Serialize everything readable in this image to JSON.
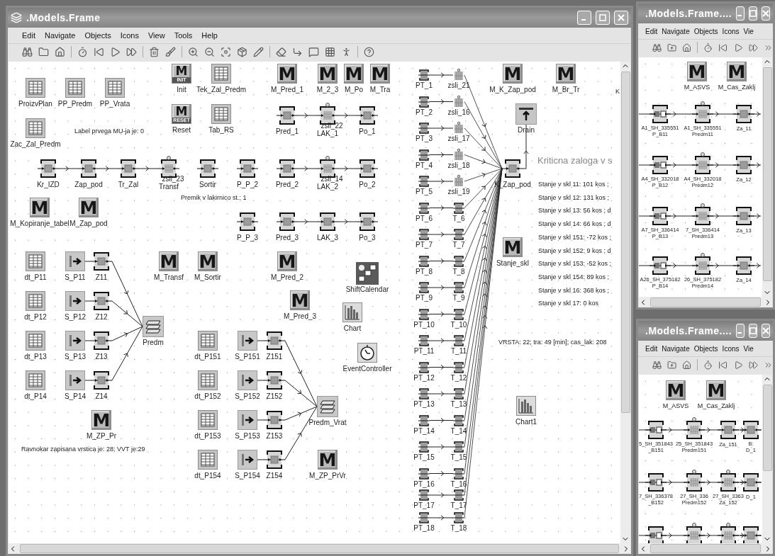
{
  "main_window": {
    "title": ".Models.Frame",
    "menu": [
      "Edit",
      "Navigate",
      "Objects",
      "Icons",
      "View",
      "Tools",
      "Help"
    ],
    "nodes": [
      {
        "kind": "table",
        "label": "ProizvPlan"
      },
      {
        "kind": "table",
        "label": "PP_Predm"
      },
      {
        "kind": "table",
        "label": "PP_Vrata"
      },
      {
        "kind": "init",
        "label": "Init",
        "icon": "M",
        "badge": "INIT"
      },
      {
        "kind": "table",
        "label": "Tek_Zal_Predm"
      },
      {
        "kind": "method",
        "label": "M_Pred_1",
        "icon": "M"
      },
      {
        "kind": "method",
        "label": "M_2_3",
        "icon": "M"
      },
      {
        "kind": "method",
        "label": "M_Po",
        "icon": "M"
      },
      {
        "kind": "method",
        "label": "M_Tra",
        "icon": "M"
      },
      {
        "kind": "method",
        "label": "M_K_Zap_pod",
        "icon": "M"
      },
      {
        "kind": "method",
        "label": "M_Br_Tr",
        "icon": "M"
      },
      {
        "kind": "table",
        "label": "Zac_Zal_Predm"
      },
      {
        "kind": "init",
        "label": "Reset",
        "icon": "M",
        "badge": "RESET"
      },
      {
        "kind": "table",
        "label": "Tab_RS"
      },
      {
        "kind": "station",
        "label": "Pred_1"
      },
      {
        "kind": "parallel",
        "label": "LAK_1",
        "sublabel": "zsli_22"
      },
      {
        "kind": "station",
        "label": "Po_1"
      },
      {
        "kind": "drain",
        "label": "Drain"
      },
      {
        "kind": "station",
        "label": "Kr_IZD"
      },
      {
        "kind": "station",
        "label": "Zap_pod"
      },
      {
        "kind": "station",
        "label": "Tr_Zal"
      },
      {
        "kind": "parallel",
        "label": "Transf",
        "sublabel": "zsli_23"
      },
      {
        "kind": "station",
        "label": "Sortir"
      },
      {
        "kind": "station",
        "label": "P_P_2"
      },
      {
        "kind": "station",
        "label": "Pred_2"
      },
      {
        "kind": "parallel",
        "label": "LAK_2",
        "sublabel": "zsli_14"
      },
      {
        "kind": "station",
        "label": "Po_2"
      },
      {
        "kind": "station",
        "label": "K_Zap_pod"
      },
      {
        "kind": "method",
        "label": "M_Kopiranje_tabel",
        "icon": "M"
      },
      {
        "kind": "method",
        "label": "M_Zap_pod",
        "icon": "M"
      },
      {
        "kind": "station",
        "label": "P_P_3"
      },
      {
        "kind": "station",
        "label": "Pred_3"
      },
      {
        "kind": "station",
        "label": "LAK_3"
      },
      {
        "kind": "station",
        "label": "Po_3"
      },
      {
        "kind": "method",
        "label": "Stanje_skl",
        "icon": "M"
      },
      {
        "kind": "table",
        "label": "dt_P11"
      },
      {
        "kind": "source",
        "label": "S_P11"
      },
      {
        "kind": "station",
        "label": "Z11"
      },
      {
        "kind": "method",
        "label": "M_Transf",
        "icon": "M"
      },
      {
        "kind": "method",
        "label": "M_Sortir",
        "icon": "M"
      },
      {
        "kind": "method",
        "label": "M_Pred_2",
        "icon": "M"
      },
      {
        "kind": "calendar",
        "label": "ShiftCalendar"
      },
      {
        "kind": "table",
        "label": "dt_P12"
      },
      {
        "kind": "source",
        "label": "S_P12"
      },
      {
        "kind": "station",
        "label": "Z12"
      },
      {
        "kind": "method",
        "label": "M_Pred_3",
        "icon": "M"
      },
      {
        "kind": "chart",
        "label": "Chart"
      },
      {
        "kind": "assembly",
        "label": "Predm"
      },
      {
        "kind": "table",
        "label": "dt_P13"
      },
      {
        "kind": "source",
        "label": "S_P13"
      },
      {
        "kind": "station",
        "label": "Z13"
      },
      {
        "kind": "table",
        "label": "dt_P151"
      },
      {
        "kind": "source",
        "label": "S_P151"
      },
      {
        "kind": "station",
        "label": "Z151"
      },
      {
        "kind": "event",
        "label": "EventController"
      },
      {
        "kind": "table",
        "label": "dt_P14"
      },
      {
        "kind": "source",
        "label": "S_P14"
      },
      {
        "kind": "station",
        "label": "Z14"
      },
      {
        "kind": "table",
        "label": "dt_P152"
      },
      {
        "kind": "source",
        "label": "S_P152"
      },
      {
        "kind": "station",
        "label": "Z152"
      },
      {
        "kind": "chart",
        "label": "Chart1"
      },
      {
        "kind": "assembly",
        "label": "Predm_Vrat"
      },
      {
        "kind": "method",
        "label": "M_ZP_Pr",
        "icon": "M"
      },
      {
        "kind": "table",
        "label": "dt_P153"
      },
      {
        "kind": "source",
        "label": "S_P153"
      },
      {
        "kind": "station",
        "label": "Z153"
      },
      {
        "kind": "table",
        "label": "dt_P154"
      },
      {
        "kind": "source",
        "label": "S_P154"
      },
      {
        "kind": "station",
        "label": "Z154"
      },
      {
        "kind": "method",
        "label": "M_ZP_PrVr",
        "icon": "M"
      }
    ],
    "feeders": [
      {
        "source": {
          "kind": "station",
          "label": "PT_1"
        },
        "target": {
          "kind": "parallel",
          "label": "zsli_21"
        }
      },
      {
        "source": {
          "kind": "station",
          "label": "PT_2"
        },
        "target": {
          "kind": "parallel",
          "label": "zsli_16"
        }
      },
      {
        "source": {
          "kind": "station",
          "label": "PT_3"
        },
        "target": {
          "kind": "parallel",
          "label": "zsli_17"
        }
      },
      {
        "source": {
          "kind": "station",
          "label": "PT_4"
        },
        "target": {
          "kind": "parallel",
          "label": "zsli_18"
        }
      },
      {
        "source": {
          "kind": "station",
          "label": "PT_5"
        },
        "target": {
          "kind": "parallel",
          "label": "zsli_19"
        }
      },
      {
        "source": {
          "kind": "station",
          "label": "PT_6"
        },
        "target": {
          "kind": "station",
          "label": "T_6"
        }
      },
      {
        "source": {
          "kind": "station",
          "label": "PT_7"
        },
        "target": {
          "kind": "station",
          "label": "T_7"
        }
      },
      {
        "source": {
          "kind": "station",
          "label": "PT_8"
        },
        "target": {
          "kind": "station",
          "label": "T_8"
        }
      },
      {
        "source": {
          "kind": "station",
          "label": "PT_9"
        },
        "target": {
          "kind": "station",
          "label": "T_9"
        }
      },
      {
        "source": {
          "kind": "station",
          "label": "PT_10"
        },
        "target": {
          "kind": "station",
          "label": "T_10"
        }
      },
      {
        "source": {
          "kind": "station",
          "label": "PT_11"
        },
        "target": {
          "kind": "station",
          "label": "T_11"
        }
      },
      {
        "source": {
          "kind": "station",
          "label": "PT_12"
        },
        "target": {
          "kind": "station",
          "label": "T_12"
        }
      },
      {
        "source": {
          "kind": "station",
          "label": "PT_13"
        },
        "target": {
          "kind": "station",
          "label": "T_13"
        }
      },
      {
        "source": {
          "kind": "station",
          "label": "PT_14"
        },
        "target": {
          "kind": "station",
          "label": "T_14"
        }
      },
      {
        "source": {
          "kind": "station",
          "label": "PT_15"
        },
        "target": {
          "kind": "station",
          "label": "T_15"
        }
      },
      {
        "source": {
          "kind": "station",
          "label": "PT_16"
        },
        "target": {
          "kind": "station",
          "label": "T_16"
        }
      },
      {
        "source": {
          "kind": "station",
          "label": "PT_17"
        },
        "target": {
          "kind": "station",
          "label": "T_17"
        }
      },
      {
        "source": {
          "kind": "station",
          "label": "PT_18"
        },
        "target": {
          "kind": "station",
          "label": "T_18"
        }
      }
    ],
    "texts": [
      {
        "kind": "note",
        "text": "Label prvega MU-ja je: 0"
      },
      {
        "kind": "note",
        "text": "K"
      },
      {
        "kind": "heading",
        "text": "Kriticna zaloga v s"
      },
      {
        "kind": "note",
        "text": "Stanje v skl 11: 101 kos  ;"
      },
      {
        "kind": "note",
        "text": "Stanje v skl 12: 131 kos  ;"
      },
      {
        "kind": "note",
        "text": "Stanje v skl 13: 56 kos  ; d"
      },
      {
        "kind": "note",
        "text": "Stanje v skl 14: 66 kos  ; d"
      },
      {
        "kind": "note",
        "text": "Stanje v skl 151: -72 kos  ;"
      },
      {
        "kind": "note",
        "text": "Stanje v skl 152: 9 kos  ; d"
      },
      {
        "kind": "note",
        "text": "Stanje v skl 153: -52 kos  ;"
      },
      {
        "kind": "note",
        "text": "Stanje v skl 154: 89 kos  ;"
      },
      {
        "kind": "note",
        "text": "Stanje v skl 16: 368 kos  ;"
      },
      {
        "kind": "note",
        "text": "Stanje v skl 17: 0 kos"
      },
      {
        "kind": "note",
        "text": "Premik v lakirnico st.: 1"
      },
      {
        "kind": "note",
        "text": "VRSTA: 22; tra: 49 [min]; cas_lak: 208"
      },
      {
        "kind": "note",
        "text": "Ravnokar zapisana vrstica je: 28; VVT je:29"
      }
    ]
  },
  "side_windows": [
    {
      "title": ".Models.Frame....",
      "menu": [
        "Edit",
        "Navigate",
        "Objects",
        "Icons",
        "Vie"
      ],
      "modules": [
        {
          "icon": "M",
          "label": "M_ASVS"
        },
        {
          "icon": "M",
          "label": "M_Cas_Zaklj"
        }
      ],
      "rows": [
        {
          "nodes": [
            {
              "kind": "batch",
              "sublabel": "A1_SH_335551",
              "label": "P_B11"
            },
            {
              "kind": "parallel",
              "sublabel": "A1_SH_335551",
              "label": "Predm11"
            },
            {
              "kind": "station",
              "label": "Za_11"
            }
          ]
        },
        {
          "nodes": [
            {
              "kind": "batch",
              "sublabel": "A4_SH_332018",
              "label": "P_B12"
            },
            {
              "kind": "parallel",
              "sublabel": "A4_SH_332018",
              "label": "Predm12"
            },
            {
              "kind": "station",
              "label": "Za_12"
            }
          ]
        },
        {
          "nodes": [
            {
              "kind": "batch",
              "sublabel": "A7_SH_336414",
              "label": "P_B13"
            },
            {
              "kind": "parallel",
              "sublabel": "7_SH_336414",
              "label": "Predm13"
            },
            {
              "kind": "station",
              "label": "Za_13"
            }
          ]
        },
        {
          "nodes": [
            {
              "kind": "batch",
              "sublabel": "A26_SH_375182",
              "label": "P_B14"
            },
            {
              "kind": "parallel",
              "sublabel": "26_SH_375182",
              "label": "Predm14"
            },
            {
              "kind": "station",
              "label": "Za_14"
            }
          ]
        }
      ]
    },
    {
      "title": ".Models.Frame....",
      "menu": [
        "Edit",
        "Navigate",
        "Objects",
        "Icons",
        "Vie"
      ],
      "modules": [
        {
          "icon": "M",
          "label": "M_ASVS"
        },
        {
          "icon": "M",
          "label": "M_Cas_Zaklj"
        }
      ],
      "rows": [
        {
          "nodes": [
            {
              "kind": "batch",
              "sublabel": "5_SH_351843",
              "label": "_B151"
            },
            {
              "kind": "parallel",
              "sublabel": "25_SH_351843",
              "label": "Predm151"
            },
            {
              "kind": "station",
              "label": "Za_151"
            },
            {
              "kind": "station",
              "sublabel": "B:",
              "label": "D_1"
            }
          ]
        },
        {
          "nodes": [
            {
              "kind": "batch",
              "sublabel": "7_SH_336378",
              "label": "_B152"
            },
            {
              "kind": "parallel",
              "sublabel": "27_SH_336",
              "label": "Predm152"
            },
            {
              "kind": "parallel",
              "sublabel": "27_SH_3363",
              "label": "Za_152"
            },
            {
              "kind": "station",
              "label": "D_1"
            }
          ]
        },
        {
          "nodes": [
            {
              "kind": "batch"
            },
            {
              "kind": "parallel"
            },
            {
              "kind": "parallel"
            },
            {
              "kind": "station"
            }
          ]
        }
      ]
    }
  ]
}
